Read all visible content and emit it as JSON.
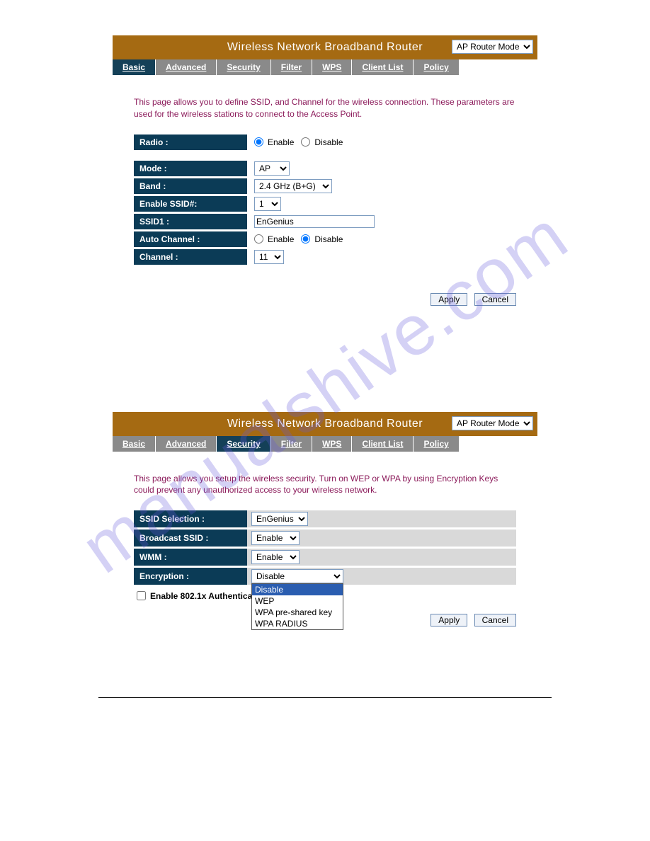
{
  "watermark_text": "manualshive.com",
  "panel_basic": {
    "title": "Wireless Network Broadband Router",
    "mode": "AP Router Mode",
    "tabs": [
      "Basic",
      "Advanced",
      "Security",
      "Filter",
      "WPS",
      "Client List",
      "Policy"
    ],
    "active_tab": "Basic",
    "description": "This page allows you to define SSID, and Channel for the wireless connection. These parameters are used for the wireless stations to connect to the Access Point.",
    "rows": {
      "radio_label": "Radio :",
      "radio_enable": "Enable",
      "radio_disable": "Disable",
      "mode_label": "Mode :",
      "mode_value": "AP",
      "band_label": "Band :",
      "band_value": "2.4 GHz (B+G)",
      "enable_ssid_label": "Enable SSID#:",
      "enable_ssid_value": "1",
      "ssid1_label": "SSID1 :",
      "ssid1_value": "EnGenius",
      "auto_channel_label": "Auto Channel :",
      "auto_channel_enable": "Enable",
      "auto_channel_disable": "Disable",
      "channel_label": "Channel :",
      "channel_value": "11"
    },
    "buttons": {
      "apply": "Apply",
      "cancel": "Cancel"
    }
  },
  "panel_security": {
    "title": "Wireless Network Broadband Router",
    "mode": "AP Router Mode",
    "tabs": [
      "Basic",
      "Advanced",
      "Security",
      "Filter",
      "WPS",
      "Client List",
      "Policy"
    ],
    "active_tab": "Security",
    "description": "This page allows you setup the wireless security. Turn on WEP or WPA by using Encryption Keys could prevent any unauthorized access to your wireless network.",
    "rows": {
      "ssid_selection_label": "SSID Selection :",
      "ssid_selection_value": "EnGenius",
      "broadcast_ssid_label": "Broadcast SSID :",
      "broadcast_ssid_value": "Enable",
      "wmm_label": "WMM :",
      "wmm_value": "Enable",
      "encryption_label": "Encryption :",
      "encryption_value": "Disable",
      "encryption_options": [
        "Disable",
        "WEP",
        "WPA pre-shared key",
        "WPA RADIUS"
      ]
    },
    "checkbox_label": "Enable 802.1x Authentication",
    "buttons": {
      "apply": "Apply",
      "cancel": "Cancel"
    }
  }
}
